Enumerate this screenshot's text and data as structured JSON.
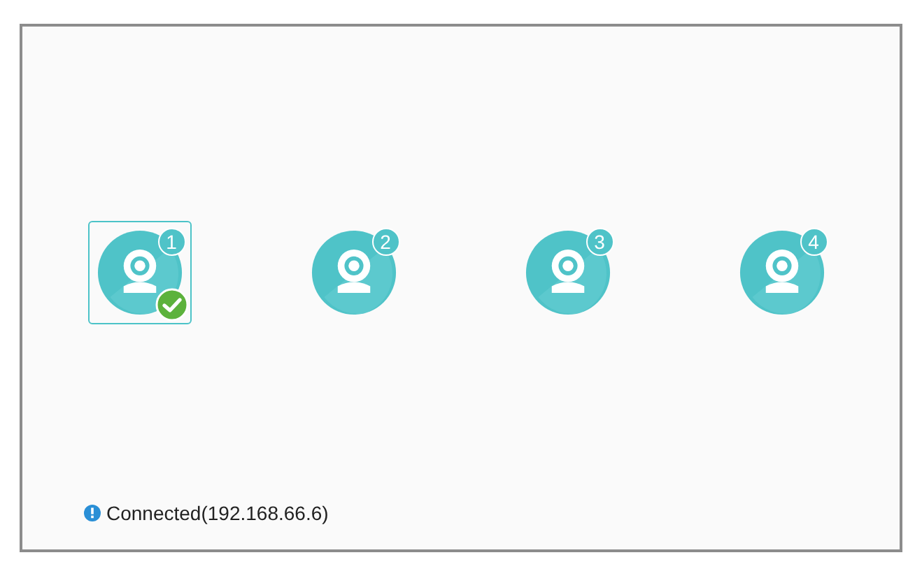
{
  "cameras": [
    {
      "number": "1",
      "selected": true
    },
    {
      "number": "2",
      "selected": false
    },
    {
      "number": "3",
      "selected": false
    },
    {
      "number": "4",
      "selected": false
    }
  ],
  "status": {
    "text": "Connected(192.168.66.6)"
  }
}
